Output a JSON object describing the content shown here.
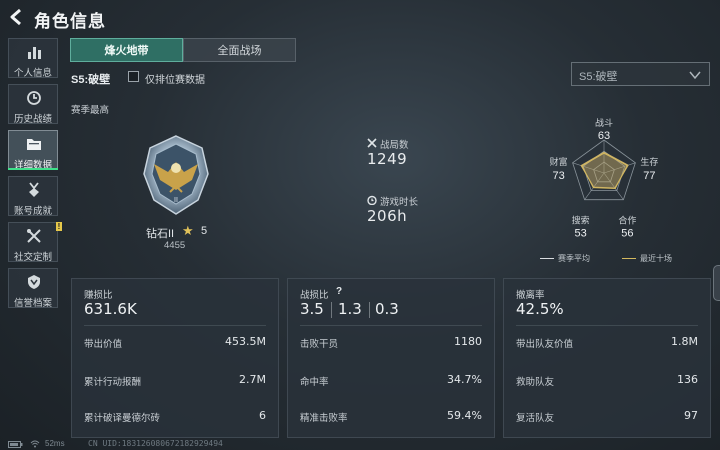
{
  "header": {
    "title": "角色信息"
  },
  "sidebar": {
    "items": [
      {
        "label": "个人信息",
        "icon": "bar-chart-icon",
        "active": false
      },
      {
        "label": "历史战绩",
        "icon": "history-icon",
        "active": false
      },
      {
        "label": "详细数据",
        "icon": "folder-icon",
        "active": true
      },
      {
        "label": "账号成就",
        "icon": "medal-icon",
        "active": false
      },
      {
        "label": "社交定制",
        "icon": "tools-icon",
        "active": false,
        "badge": "!"
      },
      {
        "label": "信誉档案",
        "icon": "shield-icon",
        "active": false
      }
    ]
  },
  "tabs": [
    {
      "label": "烽火地带",
      "active": true
    },
    {
      "label": "全面战场",
      "active": false
    }
  ],
  "filter": {
    "season": "S5:破壁",
    "ranked_only_label": "仅排位赛数据",
    "ranked_only_checked": false,
    "season_select_value": "S5:破壁"
  },
  "season_best": {
    "label": "赛季最高",
    "rank_name": "钻石II",
    "stars": "5",
    "score": "4455"
  },
  "stats": {
    "matches_label": "战局数",
    "matches_value": "1249",
    "playtime_label": "游戏时长",
    "playtime_value": "206h"
  },
  "radar": {
    "axes": [
      {
        "label": "战斗",
        "value": "63"
      },
      {
        "label": "生存",
        "value": "77"
      },
      {
        "label": "合作",
        "value": "56"
      },
      {
        "label": "搜索",
        "value": "53"
      },
      {
        "label": "财富",
        "value": "73"
      }
    ],
    "values": [
      63,
      77,
      56,
      53,
      73
    ],
    "recent_values": [
      60,
      74,
      58,
      55,
      70
    ],
    "legend_season": "赛季平均",
    "legend_recent": "最近十场",
    "colors": {
      "season": "#c9b06a",
      "recent": "#d4b95e",
      "grid": "#8a949b"
    }
  },
  "panels": {
    "profit": {
      "title": "赚损比",
      "main": "631.6K",
      "rows": [
        {
          "label": "带出价值",
          "value": "453.5M"
        },
        {
          "label": "累计行动报酬",
          "value": "2.7M"
        },
        {
          "label": "累计破译曼德尔砖",
          "value": "6"
        }
      ]
    },
    "combat": {
      "title": "战损比",
      "help": "?",
      "ratios": [
        "3.5",
        "1.3",
        "0.3"
      ],
      "rows": [
        {
          "label": "击败干员",
          "value": "1180"
        },
        {
          "label": "命中率",
          "value": "34.7%"
        },
        {
          "label": "精准击败率",
          "value": "59.4%"
        }
      ]
    },
    "extract": {
      "title": "撤离率",
      "main": "42.5%",
      "rows": [
        {
          "label": "带出队友价值",
          "value": "1.8M"
        },
        {
          "label": "救助队友",
          "value": "136"
        },
        {
          "label": "复活队友",
          "value": "97"
        }
      ]
    }
  },
  "footer": {
    "ping": "52ms",
    "uid": "CN UID:1831260806721829294​94"
  }
}
